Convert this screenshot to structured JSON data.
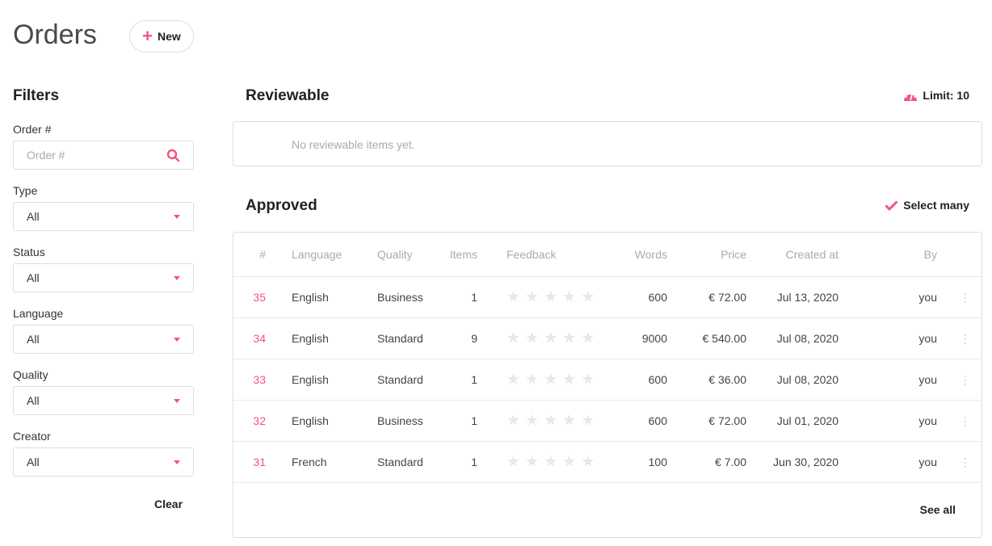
{
  "header": {
    "title": "Orders",
    "new_label": "New"
  },
  "filters": {
    "title": "Filters",
    "order_label": "Order #",
    "order_placeholder": "Order #",
    "selects": [
      {
        "label": "Type",
        "value": "All"
      },
      {
        "label": "Status",
        "value": "All"
      },
      {
        "label": "Language",
        "value": "All"
      },
      {
        "label": "Quality",
        "value": "All"
      },
      {
        "label": "Creator",
        "value": "All"
      }
    ],
    "clear_label": "Clear"
  },
  "reviewable": {
    "title": "Reviewable",
    "limit": "Limit: 10",
    "empty": "No reviewable items yet."
  },
  "approved": {
    "title": "Approved",
    "select_many": "Select many",
    "see_all": "See all",
    "columns": [
      "#",
      "Language",
      "Quality",
      "Items",
      "Feedback",
      "Words",
      "Price",
      "Created at",
      "By"
    ],
    "rows": [
      {
        "id": "35",
        "language": "English",
        "quality": "Business",
        "items": "1",
        "rating": 0,
        "words": "600",
        "price": "€ 72.00",
        "created": "Jul 13, 2020",
        "by": "you"
      },
      {
        "id": "34",
        "language": "English",
        "quality": "Standard",
        "items": "9",
        "rating": 0,
        "words": "9000",
        "price": "€ 540.00",
        "created": "Jul 08, 2020",
        "by": "you"
      },
      {
        "id": "33",
        "language": "English",
        "quality": "Standard",
        "items": "1",
        "rating": 0,
        "words": "600",
        "price": "€ 36.00",
        "created": "Jul 08, 2020",
        "by": "you"
      },
      {
        "id": "32",
        "language": "English",
        "quality": "Business",
        "items": "1",
        "rating": 0,
        "words": "600",
        "price": "€ 72.00",
        "created": "Jul 01, 2020",
        "by": "you"
      },
      {
        "id": "31",
        "language": "French",
        "quality": "Standard",
        "items": "1",
        "rating": 0,
        "words": "100",
        "price": "€ 7.00",
        "created": "Jun 30, 2020",
        "by": "you"
      }
    ]
  },
  "colors": {
    "accent": "#f5547c"
  }
}
